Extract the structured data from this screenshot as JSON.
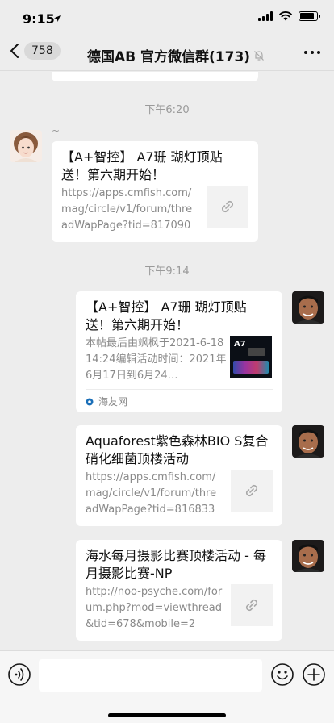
{
  "status_bar": {
    "time": "9:15",
    "battery_level": 0.85
  },
  "nav": {
    "back_badge": "758",
    "title": "德国AB  官方微信群(173)"
  },
  "colors": {
    "background": "#ededed",
    "bubble": "#ffffff",
    "meta_text": "#9a9a9a",
    "source_logo": "#1a6fb8"
  },
  "messages": [
    {
      "time": "下午6:20"
    },
    {
      "sender_name": "~",
      "card": {
        "title": "【A+智控】 A7珊 瑚灯顶贴送！第六期开始！",
        "desc": "https://apps.cmfish.com/mag/circle/v1/forum/threadWapPage?tid=817090&…",
        "thumb": "link-icon"
      }
    },
    {
      "time": "下午9:14"
    },
    {
      "card": {
        "title": "【A+智控】 A7珊 瑚灯顶贴送！第六期开始！",
        "desc": "本帖最后由飒枫于2021-6-1814:24编辑活动时间：2021年6月17日到6月24…",
        "thumb_text": "A7",
        "source": "海友网"
      }
    },
    {
      "card": {
        "title": "Aquaforest紫色森林BIO S复合硝化细菌顶楼活动",
        "desc": "https://apps.cmfish.com/mag/circle/v1/forum/threadWapPage?tid=816833&…",
        "thumb": "link-icon"
      }
    },
    {
      "card": {
        "title": "海水每月摄影比赛顶楼活动 - 每月摄影比赛-NP",
        "desc": "http://noo-psyche.com/forum.php?mod=viewthread&tid=678&mobile=2",
        "thumb": "link-icon"
      }
    }
  ]
}
